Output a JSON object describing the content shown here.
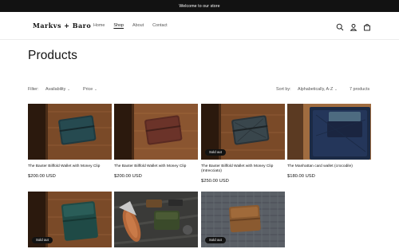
{
  "announcement": "Welcome to our store",
  "header": {
    "logo": "Markvs + Baro",
    "nav": [
      "Home",
      "Shop",
      "About",
      "Contact"
    ],
    "icons": [
      "search-icon",
      "account-icon",
      "cart-icon"
    ]
  },
  "page_title": "Products",
  "filters": {
    "filter_label": "Filter:",
    "availability": "Availability",
    "price": "Price",
    "sort_label": "Sort by:",
    "sort_value": "Alphabetically, A-Z",
    "count": "7 products"
  },
  "badge_sold_out": "Sold out",
  "products": [
    {
      "title": "The Baxter Billfold Wallet with Money Clip",
      "price": "$200.00 USD",
      "sold_out": false
    },
    {
      "title": "The Baxter Billfold Wallet with Money Clip",
      "price": "$200.00 USD",
      "sold_out": false
    },
    {
      "title": "The Baxter Billfold Wallet with Money Clip (Intrecciato)",
      "price": "$250.00 USD",
      "sold_out": true
    },
    {
      "title": "The Manhattan card wallet (crocodile)",
      "price": "$180.00 USD",
      "sold_out": false
    },
    {
      "title": "",
      "price": "",
      "sold_out": true
    },
    {
      "title": "",
      "price": "",
      "sold_out": false
    },
    {
      "title": "",
      "price": "",
      "sold_out": true
    }
  ]
}
